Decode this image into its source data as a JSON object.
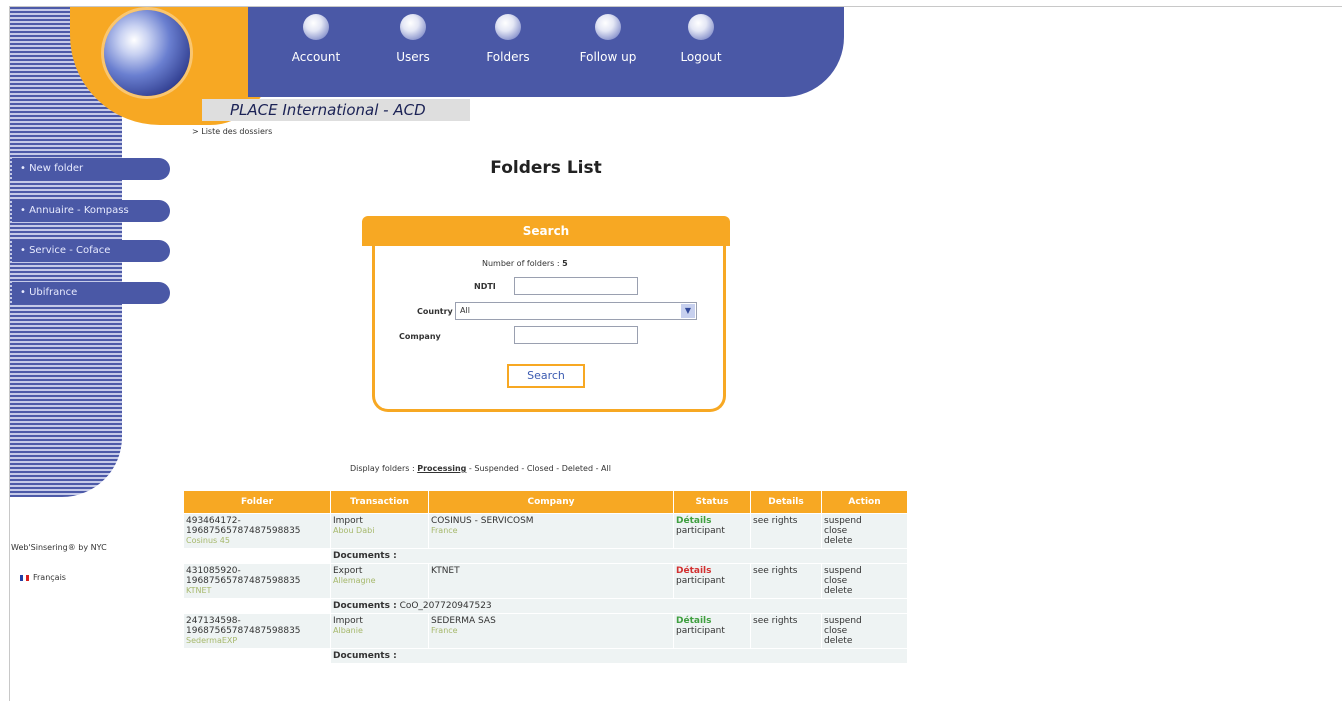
{
  "app": {
    "title": "PLACE International - ACD"
  },
  "nav": {
    "items": [
      {
        "label": "Account"
      },
      {
        "label": "Users"
      },
      {
        "label": "Folders"
      },
      {
        "label": "Follow up"
      },
      {
        "label": "Logout"
      }
    ]
  },
  "breadcrumb": "> Liste des dossiers",
  "sidebar": {
    "items": [
      {
        "label": "• New folder"
      },
      {
        "label": "• Annuaire - Kompass"
      },
      {
        "label": "• Service - Coface"
      },
      {
        "label": "• Ubifrance"
      }
    ],
    "powered_by": "Web'Sinsering® by NYC",
    "language": "Français"
  },
  "page_title": "Folders List",
  "search": {
    "title": "Search",
    "count_label": "Number of folders :",
    "count_value": "5",
    "ndti_label": "NDTI",
    "ndti_value": "",
    "country_label": "Country",
    "country_value": "All",
    "company_label": "Company",
    "company_value": "",
    "button_label": "Search"
  },
  "filters": {
    "prefix": "Display folders :",
    "items": [
      {
        "label": "Processing",
        "active": true
      },
      {
        "label": "Suspended"
      },
      {
        "label": "Closed"
      },
      {
        "label": "Deleted"
      },
      {
        "label": "All"
      }
    ]
  },
  "table": {
    "headers": [
      "Folder",
      "Transaction",
      "Company",
      "Status",
      "Details",
      "Action"
    ],
    "rows": [
      {
        "folder_id": "493464172-",
        "folder_num": "19687565787487598835",
        "folder_name": "Cosinus 45",
        "transaction": "Import",
        "transaction_place": "Abou Dabi",
        "company": "COSINUS - SERVICOSM",
        "company_country": "France",
        "status_link": "Détails",
        "status_text": "participant",
        "details": "see rights",
        "actions": [
          "suspend",
          "close",
          "delete"
        ],
        "documents_label": "Documents :",
        "documents": ""
      },
      {
        "folder_id": "431085920-",
        "folder_num": "19687565787487598835",
        "folder_name": "KTNET",
        "transaction": "Export",
        "transaction_place": "Allemagne",
        "company": "KTNET",
        "company_country": "",
        "status_link": "Détails",
        "status_text": "participant",
        "details": "see rights",
        "actions": [
          "suspend",
          "close",
          "delete"
        ],
        "documents_label": "Documents :",
        "documents": "CoO_207720947523"
      },
      {
        "folder_id": "247134598-",
        "folder_num": "19687565787487598835",
        "folder_name": "SedermaEXP",
        "transaction": "Import",
        "transaction_place": "Albanie",
        "company": "SEDERMA SAS",
        "company_country": "France",
        "status_link": "Détails",
        "status_text": "participant",
        "details": "see rights",
        "actions": [
          "suspend",
          "close",
          "delete"
        ],
        "documents_label": "Documents :",
        "documents": ""
      }
    ]
  },
  "colors": {
    "accent_orange": "#f7a823",
    "nav_blue": "#4a58a6",
    "status_green": "#3f9f3f",
    "status_red": "#d23030"
  }
}
